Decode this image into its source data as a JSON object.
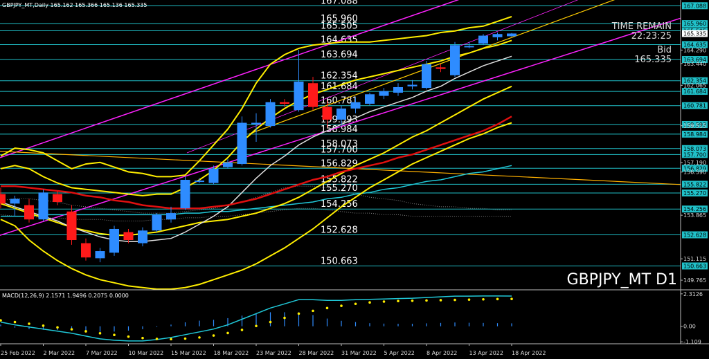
{
  "header": {
    "main": "GBPJPY_MT,Daily  165.162 165.366 165.136 165.335",
    "macd": "MACD(12,26,9) 2.1571 1.9496 0.2075 0.0000"
  },
  "symbol_label": "GBPJPY_MT D1",
  "info": {
    "time_remain_label": "TIME REMAIN",
    "time_remain_value": "22:23:25",
    "bid_label": "Bid",
    "bid_value": "165.335"
  },
  "colors": {
    "bull": "#2e8cff",
    "bear": "#ff1a1a",
    "level_line": "#20c0c8",
    "bollinger": "#ffee00",
    "ma_red": "#e01010",
    "ma_white": "#e0e0e0",
    "ma_cyan": "#20c8d8",
    "trend_magenta": "#ff22ff",
    "trend_yellow": "#ffcc00",
    "trend_orange": "#ffb000",
    "macd_signal": "#ffee00",
    "macd_hist": "#2e8cff"
  },
  "chart_data": [
    {
      "type": "candlestick",
      "y_axis_labels": [
        {
          "value": 167.088,
          "text": "167.088",
          "tagged": true
        },
        {
          "value": 165.96,
          "text": "165.960",
          "tagged": true
        },
        {
          "value": 165.505,
          "text": "165.505",
          "tagged": true
        },
        {
          "value": 165.335,
          "text": "165.335",
          "tagged": false,
          "current": true
        },
        {
          "value": 164.635,
          "text": "164.635",
          "tagged": true
        },
        {
          "value": 164.29,
          "text": "164.290",
          "tagged": false
        },
        {
          "value": 163.694,
          "text": "163.694",
          "tagged": true
        },
        {
          "value": 163.44,
          "text": "163.440",
          "tagged": false
        },
        {
          "value": 162.354,
          "text": "162.354",
          "tagged": true
        },
        {
          "value": 162.065,
          "text": "162.065",
          "tagged": false
        },
        {
          "value": 161.684,
          "text": "161.684",
          "tagged": true
        },
        {
          "value": 160.781,
          "text": "160.781",
          "tagged": true
        },
        {
          "value": 159.593,
          "text": "159.593",
          "tagged": true
        },
        {
          "value": 159.515,
          "text": "159.515",
          "tagged": false
        },
        {
          "value": 158.984,
          "text": "158.984",
          "tagged": true
        },
        {
          "value": 158.073,
          "text": "158.073",
          "tagged": true
        },
        {
          "value": 157.7,
          "text": "157.700",
          "tagged": true
        },
        {
          "value": 157.19,
          "text": "157.190",
          "tagged": false
        },
        {
          "value": 156.829,
          "text": "156.829",
          "tagged": true
        },
        {
          "value": 156.59,
          "text": "156.590",
          "tagged": false
        },
        {
          "value": 155.822,
          "text": "155.822",
          "tagged": true
        },
        {
          "value": 155.27,
          "text": "155.270",
          "tagged": true
        },
        {
          "value": 154.256,
          "text": "154.256",
          "tagged": true
        },
        {
          "value": 153.865,
          "text": "153.865",
          "tagged": false
        },
        {
          "value": 152.628,
          "text": "152.628",
          "tagged": true
        },
        {
          "value": 151.115,
          "text": "151.115",
          "tagged": false
        },
        {
          "value": 150.663,
          "text": "150.663",
          "tagged": true
        },
        {
          "value": 149.765,
          "text": "149.765",
          "tagged": false
        }
      ],
      "levels": [
        {
          "value": 167.088,
          "label": "167.088"
        },
        {
          "value": 165.96,
          "label": "165.960"
        },
        {
          "value": 165.505,
          "label": "165.505"
        },
        {
          "value": 164.635,
          "label": "164.635"
        },
        {
          "value": 163.694,
          "label": "163.694"
        },
        {
          "value": 162.354,
          "label": "162.354"
        },
        {
          "value": 161.684,
          "label": "161.684"
        },
        {
          "value": 160.781,
          "label": "160.781"
        },
        {
          "value": 159.593,
          "label": "159.593"
        },
        {
          "value": 158.984,
          "label": "158.984"
        },
        {
          "value": 158.073,
          "label": "158.073"
        },
        {
          "value": 157.7,
          "label": "157.700"
        },
        {
          "value": 156.829,
          "label": "156.829"
        },
        {
          "value": 155.822,
          "label": "155.822"
        },
        {
          "value": 155.27,
          "label": "155.270"
        },
        {
          "value": 154.256,
          "label": "154.256"
        },
        {
          "value": 152.628,
          "label": "152.628"
        },
        {
          "value": 150.663,
          "label": "150.663"
        }
      ],
      "candles": [
        {
          "o": 155.2,
          "h": 155.6,
          "l": 154.3,
          "c": 154.6
        },
        {
          "o": 154.6,
          "h": 155.1,
          "l": 153.8,
          "c": 154.9
        },
        {
          "o": 154.5,
          "h": 154.9,
          "l": 153.4,
          "c": 153.6
        },
        {
          "o": 153.6,
          "h": 155.5,
          "l": 153.5,
          "c": 155.3
        },
        {
          "o": 155.2,
          "h": 155.4,
          "l": 154.5,
          "c": 154.7
        },
        {
          "o": 154.1,
          "h": 154.5,
          "l": 152.0,
          "c": 152.3
        },
        {
          "o": 152.1,
          "h": 152.4,
          "l": 151.0,
          "c": 151.2
        },
        {
          "o": 151.15,
          "h": 151.8,
          "l": 150.9,
          "c": 151.6
        },
        {
          "o": 151.5,
          "h": 153.2,
          "l": 151.3,
          "c": 153.0
        },
        {
          "o": 152.8,
          "h": 153.0,
          "l": 152.1,
          "c": 152.3
        },
        {
          "o": 152.1,
          "h": 153.1,
          "l": 151.9,
          "c": 152.9
        },
        {
          "o": 152.9,
          "h": 154.0,
          "l": 152.8,
          "c": 153.9
        },
        {
          "o": 153.6,
          "h": 154.4,
          "l": 153.4,
          "c": 154.0
        },
        {
          "o": 154.3,
          "h": 156.3,
          "l": 154.2,
          "c": 156.1
        },
        {
          "o": 156.0,
          "h": 156.2,
          "l": 155.9,
          "c": 156.05
        },
        {
          "o": 155.9,
          "h": 157.0,
          "l": 155.8,
          "c": 156.8
        },
        {
          "o": 156.9,
          "h": 157.4,
          "l": 156.8,
          "c": 157.2
        },
        {
          "o": 157.1,
          "h": 160.1,
          "l": 157.0,
          "c": 159.7
        },
        {
          "o": 159.7,
          "h": 160.3,
          "l": 158.5,
          "c": 159.7
        },
        {
          "o": 159.5,
          "h": 161.2,
          "l": 159.4,
          "c": 161.0
        },
        {
          "o": 161.0,
          "h": 161.2,
          "l": 160.7,
          "c": 160.9
        },
        {
          "o": 160.5,
          "h": 164.3,
          "l": 160.4,
          "c": 162.3
        },
        {
          "o": 162.2,
          "h": 162.6,
          "l": 160.5,
          "c": 160.7
        },
        {
          "o": 160.7,
          "h": 161.1,
          "l": 159.4,
          "c": 159.9
        },
        {
          "o": 159.9,
          "h": 160.8,
          "l": 159.5,
          "c": 160.6
        },
        {
          "o": 160.6,
          "h": 161.3,
          "l": 160.3,
          "c": 161.0
        },
        {
          "o": 160.9,
          "h": 161.6,
          "l": 160.8,
          "c": 161.5
        },
        {
          "o": 161.4,
          "h": 161.9,
          "l": 161.2,
          "c": 161.7
        },
        {
          "o": 161.6,
          "h": 162.2,
          "l": 161.4,
          "c": 161.95
        },
        {
          "o": 162.0,
          "h": 162.4,
          "l": 161.8,
          "c": 162.1
        },
        {
          "o": 161.9,
          "h": 163.6,
          "l": 161.8,
          "c": 163.4
        },
        {
          "o": 163.2,
          "h": 163.4,
          "l": 162.9,
          "c": 163.1
        },
        {
          "o": 162.7,
          "h": 164.8,
          "l": 162.6,
          "c": 164.6
        },
        {
          "o": 164.5,
          "h": 164.8,
          "l": 164.4,
          "c": 164.55
        },
        {
          "o": 164.7,
          "h": 165.3,
          "l": 164.6,
          "c": 165.2
        },
        {
          "o": 165.1,
          "h": 165.4,
          "l": 164.9,
          "c": 165.3
        },
        {
          "o": 165.162,
          "h": 165.366,
          "l": 165.136,
          "c": 165.335
        }
      ],
      "x_labels": [
        {
          "i": 0,
          "text": "25 Feb 2022"
        },
        {
          "i": 3,
          "text": "2 Mar 2022"
        },
        {
          "i": 6,
          "text": "7 Mar 2022"
        },
        {
          "i": 9,
          "text": "10 Mar 2022"
        },
        {
          "i": 12,
          "text": "15 Mar 2022"
        },
        {
          "i": 15,
          "text": "18 Mar 2022"
        },
        {
          "i": 18,
          "text": "23 Mar 2022"
        },
        {
          "i": 21,
          "text": "28 Mar 2022"
        },
        {
          "i": 24,
          "text": "31 Mar 2022"
        },
        {
          "i": 27,
          "text": "5 Apr 2022"
        },
        {
          "i": 30,
          "text": "8 Apr 2022"
        },
        {
          "i": 33,
          "text": "13 Apr 2022"
        },
        {
          "i": 36,
          "text": "18 Apr 2022"
        }
      ],
      "bollinger_outer_upper": [
        157.6,
        158.1,
        158.0,
        157.8,
        157.3,
        156.8,
        157.1,
        157.2,
        156.9,
        156.6,
        156.5,
        156.3,
        156.3,
        156.4,
        157.3,
        158.3,
        159.3,
        160.6,
        162.2,
        163.4,
        164.0,
        164.4,
        164.6,
        164.7,
        164.8,
        164.8,
        164.8,
        164.9,
        165.0,
        165.1,
        165.2,
        165.4,
        165.5,
        165.7,
        165.8,
        166.1,
        166.4
      ],
      "bollinger_inner_upper": [
        156.8,
        157.0,
        156.8,
        156.3,
        155.9,
        155.6,
        155.5,
        155.4,
        155.3,
        155.2,
        155.1,
        155.2,
        155.2,
        155.6,
        156.1,
        156.7,
        157.5,
        158.5,
        159.3,
        160.0,
        160.6,
        161.1,
        161.5,
        161.8,
        162.1,
        162.4,
        162.6,
        162.8,
        163.0,
        163.2,
        163.4,
        163.6,
        163.9,
        164.1,
        164.4,
        164.6,
        164.9
      ],
      "ma_red": [
        155.7,
        155.7,
        155.6,
        155.5,
        155.4,
        155.3,
        155.1,
        155.0,
        154.8,
        154.7,
        154.5,
        154.4,
        154.3,
        154.3,
        154.3,
        154.4,
        154.5,
        154.7,
        154.9,
        155.2,
        155.5,
        155.8,
        156.1,
        156.3,
        156.6,
        156.8,
        157.0,
        157.2,
        157.5,
        157.7,
        158.0,
        158.3,
        158.6,
        158.9,
        159.2,
        159.6,
        160.1
      ],
      "ma_white": [
        154.7,
        154.4,
        154.1,
        153.8,
        153.5,
        153.1,
        152.8,
        152.5,
        152.3,
        152.2,
        152.2,
        152.3,
        152.4,
        152.8,
        153.3,
        153.8,
        154.4,
        155.3,
        156.2,
        157.0,
        157.6,
        158.3,
        158.8,
        159.2,
        159.6,
        160.0,
        160.4,
        160.7,
        161.0,
        161.3,
        161.7,
        162.0,
        162.5,
        162.9,
        163.3,
        163.6,
        163.9
      ],
      "bollinger_inner_lower": [
        154.6,
        154.3,
        154.0,
        153.7,
        153.4,
        153.1,
        152.9,
        152.7,
        152.6,
        152.6,
        152.7,
        152.8,
        153.0,
        153.2,
        153.4,
        153.5,
        153.6,
        153.8,
        154.0,
        154.3,
        154.6,
        155.0,
        155.5,
        156.0,
        156.5,
        157.0,
        157.4,
        157.8,
        158.3,
        158.8,
        159.2,
        159.7,
        160.2,
        160.7,
        161.2,
        161.6,
        162.0
      ],
      "bollinger_outer_lower": [
        153.6,
        153.2,
        152.3,
        151.6,
        151.0,
        150.5,
        150.1,
        149.8,
        149.6,
        149.4,
        149.3,
        149.2,
        149.2,
        149.3,
        149.5,
        149.8,
        150.1,
        150.4,
        150.8,
        151.3,
        151.8,
        152.4,
        153.0,
        153.7,
        154.4,
        155.0,
        155.6,
        156.1,
        156.6,
        157.1,
        157.5,
        157.9,
        158.3,
        158.7,
        159.0,
        159.4,
        159.7
      ],
      "ma_cyan": [
        153.8,
        153.8,
        153.8,
        153.9,
        153.9,
        153.9,
        153.9,
        153.9,
        153.9,
        153.9,
        153.9,
        153.9,
        153.9,
        154.0,
        154.0,
        154.1,
        154.1,
        154.2,
        154.3,
        154.4,
        154.5,
        154.6,
        154.7,
        154.9,
        155.0,
        155.2,
        155.3,
        155.5,
        155.6,
        155.8,
        156.0,
        156.1,
        156.3,
        156.5,
        156.6,
        156.8,
        157.0
      ],
      "macd_signal": [
        0.42,
        0.3,
        0.18,
        0.04,
        -0.08,
        -0.22,
        -0.36,
        -0.5,
        -0.62,
        -0.74,
        -0.84,
        -0.9,
        -0.92,
        -0.88,
        -0.8,
        -0.66,
        -0.48,
        -0.26,
        0.02,
        0.3,
        0.6,
        0.9,
        1.1,
        1.3,
        1.46,
        1.6,
        1.7,
        1.76,
        1.8,
        1.82,
        1.84,
        1.86,
        1.88,
        1.9,
        1.92,
        1.94,
        1.95
      ],
      "macd_main": [
        0.3,
        0.1,
        -0.05,
        -0.2,
        -0.35,
        -0.5,
        -0.7,
        -0.9,
        -1.0,
        -1.05,
        -1.05,
        -0.95,
        -0.8,
        -0.6,
        -0.4,
        -0.2,
        0.1,
        0.5,
        0.9,
        1.3,
        1.6,
        1.9,
        1.9,
        1.85,
        1.85,
        1.9,
        1.92,
        1.95,
        1.98,
        2.0,
        2.05,
        2.1,
        2.15,
        2.15,
        2.16,
        2.16,
        2.157
      ],
      "macd_hist": [
        0.12,
        -0.1,
        -0.2,
        -0.25,
        -0.27,
        -0.28,
        -0.34,
        -0.4,
        -0.38,
        -0.31,
        -0.21,
        -0.05,
        0.12,
        0.28,
        0.4,
        0.46,
        0.58,
        0.76,
        0.88,
        1.0,
        1.0,
        1.0,
        0.8,
        0.55,
        0.39,
        0.3,
        0.22,
        0.19,
        0.18,
        0.18,
        0.21,
        0.24,
        0.27,
        0.25,
        0.24,
        0.22,
        0.21
      ],
      "macd_axis_labels": [
        {
          "value": 2.3126,
          "text": "2.3126"
        },
        {
          "value": 0.0,
          "text": "0.00"
        },
        {
          "value": -1.109,
          "text": "-1.109"
        }
      ],
      "ichimoku_cloud_top": [
        154.8,
        154.9,
        154.9,
        154.8,
        154.7,
        154.5,
        154.4,
        154.3,
        154.2,
        154.1,
        154.0,
        154.0,
        154.0,
        154.1,
        154.2,
        154.3,
        154.5,
        154.7,
        155.0,
        155.3,
        155.6,
        155.7,
        155.7,
        155.6,
        155.4,
        155.2,
        155.0,
        154.9,
        154.8,
        154.6,
        154.5,
        154.4,
        154.4,
        154.3,
        154.3,
        154.2,
        154.2
      ],
      "ichimoku_cloud_bottom": [
        153.9,
        153.8,
        153.8,
        153.7,
        153.7,
        153.6,
        153.6,
        153.6,
        153.5,
        153.5,
        153.5,
        153.6,
        153.6,
        153.7,
        153.7,
        153.8,
        153.8,
        153.9,
        154.0,
        154.1,
        154.2,
        154.3,
        154.3,
        154.2,
        154.1,
        154.0,
        154.0,
        153.9,
        153.9,
        153.8,
        153.8,
        153.8,
        153.8,
        153.8,
        153.8,
        153.8,
        153.8
      ]
    }
  ]
}
